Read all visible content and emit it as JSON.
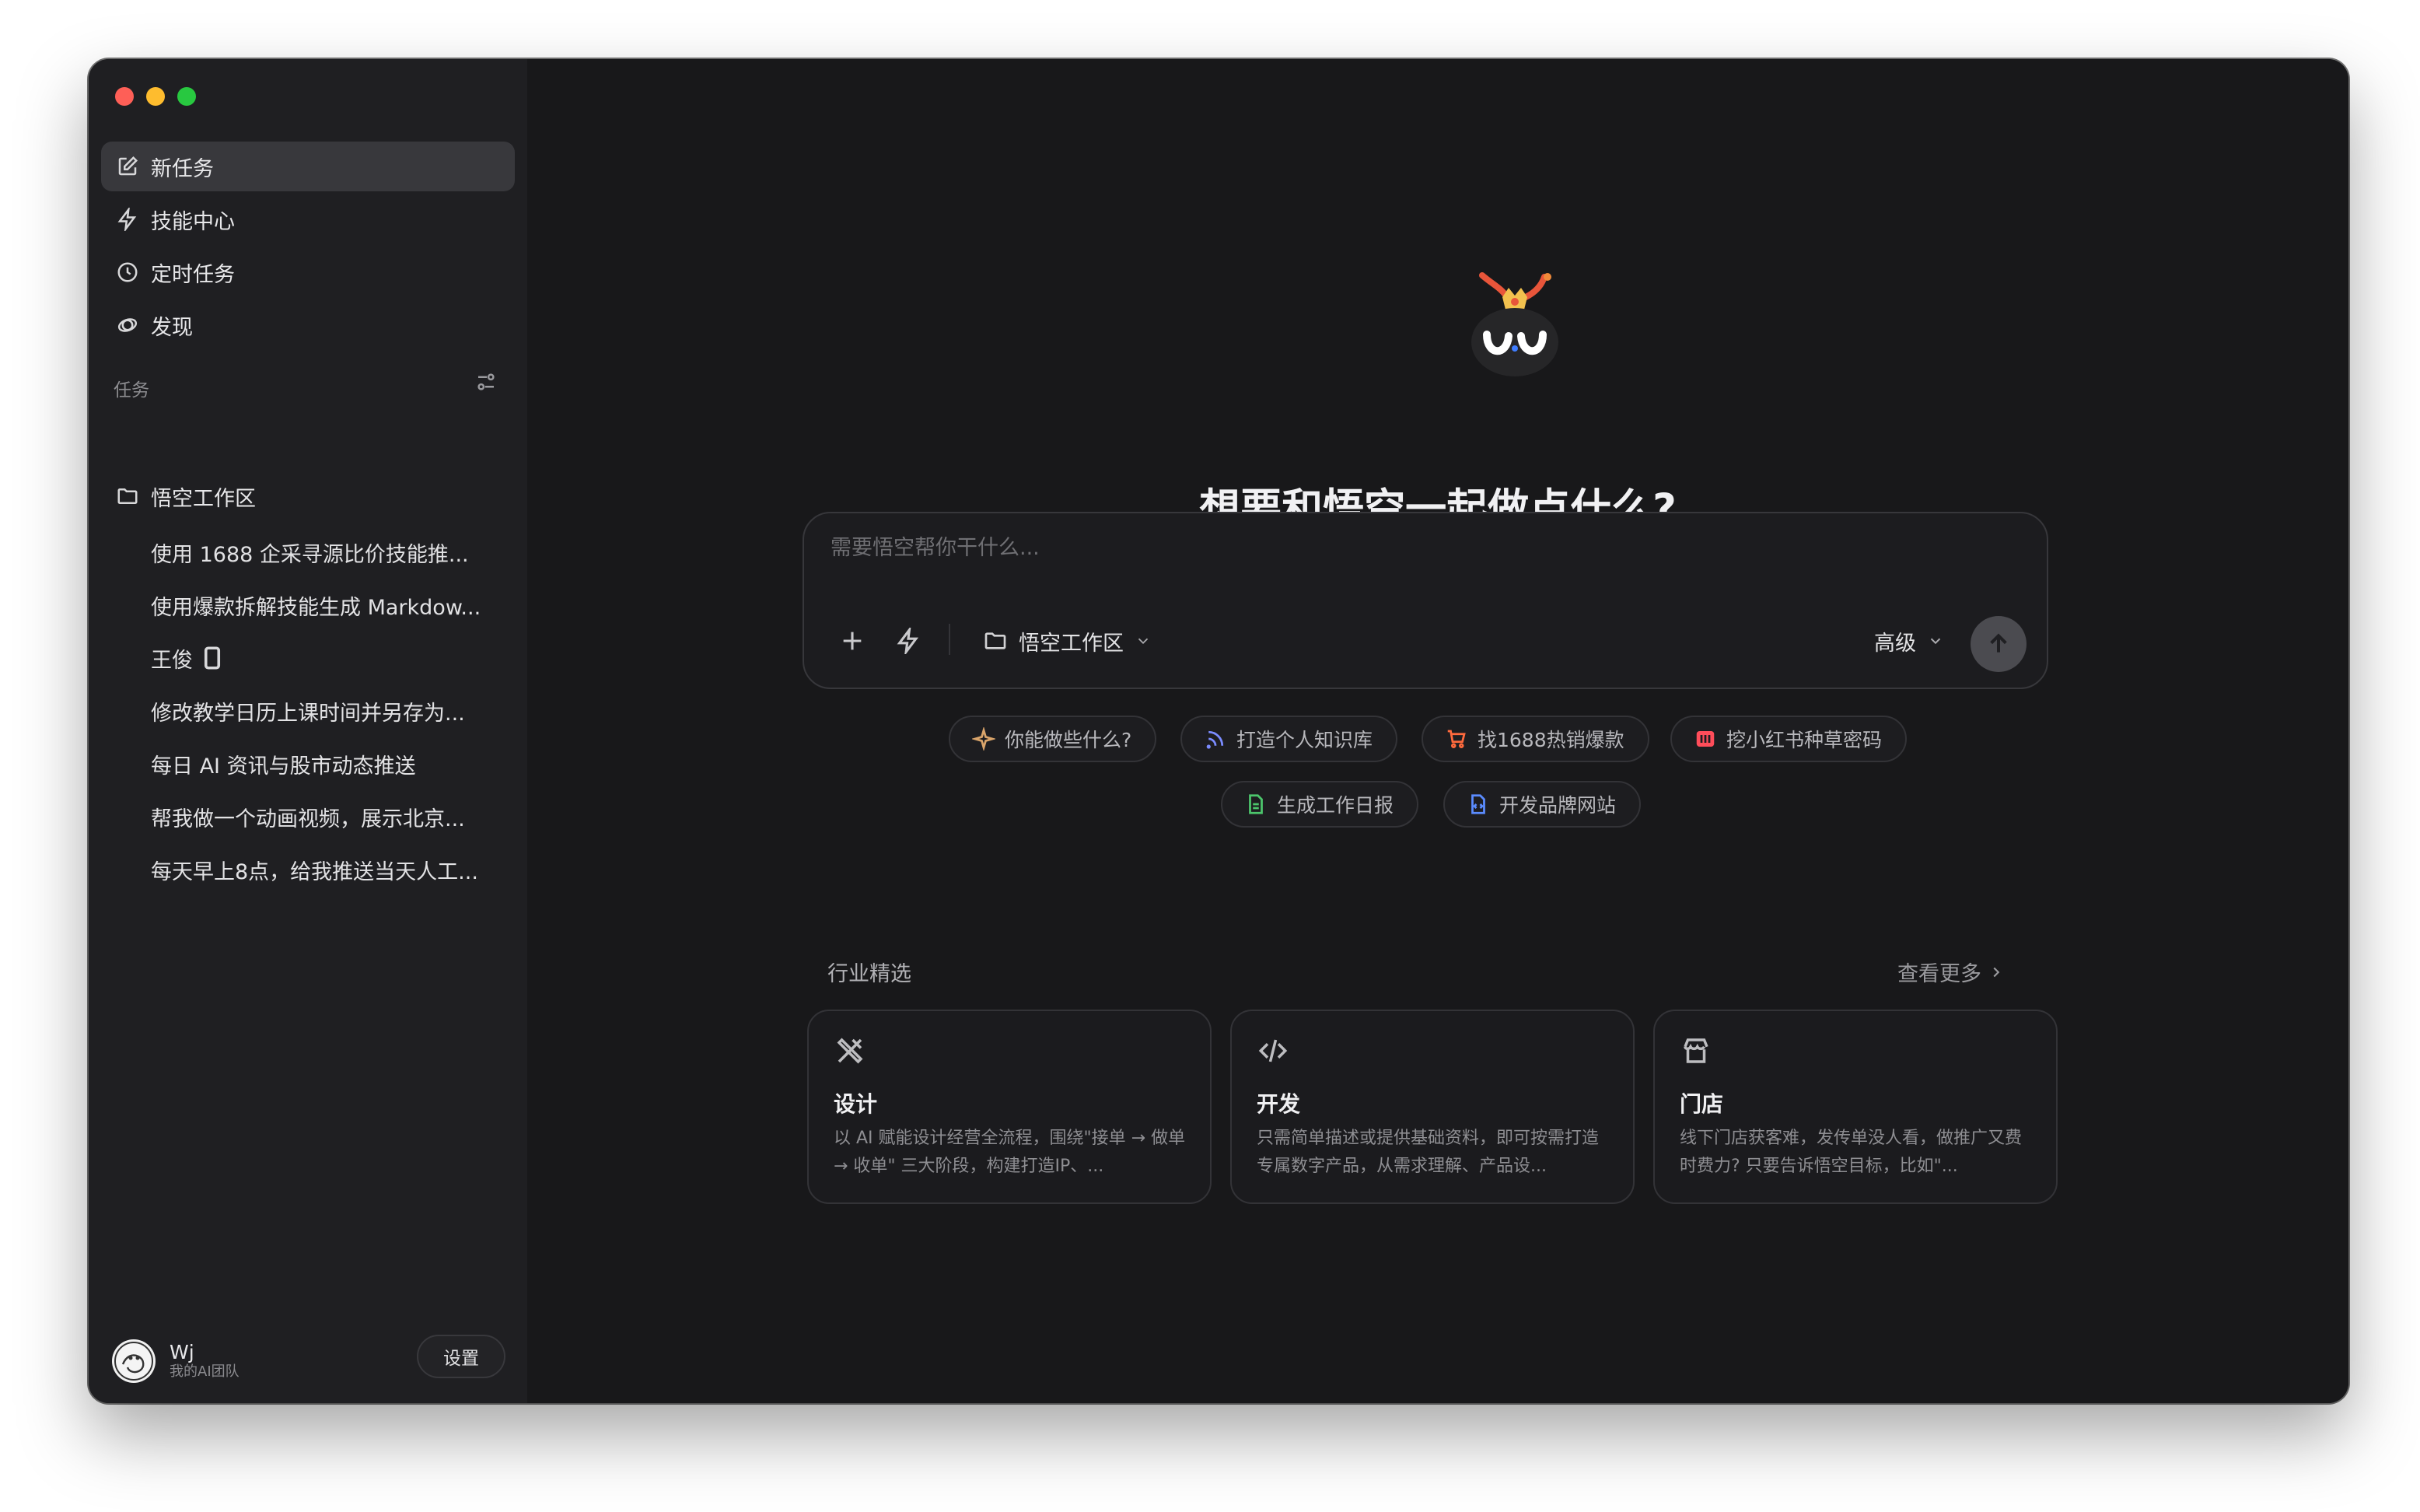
{
  "sidebar": {
    "nav": [
      {
        "label": "新任务",
        "icon": "edit-icon"
      },
      {
        "label": "技能中心",
        "icon": "bolt-icon"
      },
      {
        "label": "定时任务",
        "icon": "clock-icon"
      },
      {
        "label": "发现",
        "icon": "planet-icon"
      }
    ],
    "section_label": "任务",
    "folder": "悟空工作区",
    "tasks": [
      "使用 1688 企采寻源比价技能推...",
      "使用爆款拆解技能生成 Markdow...",
      "王俊",
      "修改教学日历上课时间并另存为...",
      "每日 AI 资讯与股市动态推送",
      "帮我做一个动画视频，展示北京...",
      "每天早上8点，给我推送当天人工..."
    ],
    "user": {
      "name": "Wj",
      "subtitle": "我的AI团队"
    },
    "settings_label": "设置"
  },
  "main": {
    "title": "想要和悟空一起做点什么?",
    "composer": {
      "placeholder": "需要悟空帮你干什么...",
      "workspace": "悟空工作区",
      "advanced": "高级"
    },
    "chips": [
      {
        "label": "你能做些什么?",
        "icon": "sparkle-icon",
        "color": "#d9a46a"
      },
      {
        "label": "打造个人知识库",
        "icon": "rss-icon",
        "color": "#7b8cff"
      },
      {
        "label": "找1688热销爆款",
        "icon": "cart-icon",
        "color": "#ff6a3d"
      },
      {
        "label": "挖小红书种草密码",
        "icon": "xiaohongshu-icon",
        "color": "#ff4d5a"
      },
      {
        "label": "生成工作日报",
        "icon": "document-icon",
        "color": "#4cc56b"
      },
      {
        "label": "开发品牌网站",
        "icon": "code-file-icon",
        "color": "#5b8cff"
      }
    ],
    "section_title": "行业精选",
    "see_more": "查看更多",
    "cards": [
      {
        "title": "设计",
        "icon": "design-tools-icon",
        "desc": "以 AI 赋能设计经营全流程，围绕\"接单 → 做单 → 收单\" 三大阶段，构建打造IP、..."
      },
      {
        "title": "开发",
        "icon": "code-icon",
        "desc": "只需简单描述或提供基础资料，即可按需打造专属数字产品，从需求理解、产品设..."
      },
      {
        "title": "门店",
        "icon": "store-icon",
        "desc": "线下门店获客难，发传单没人看，做推广又费时费力? 只要告诉悟空目标，比如\"..."
      }
    ]
  }
}
